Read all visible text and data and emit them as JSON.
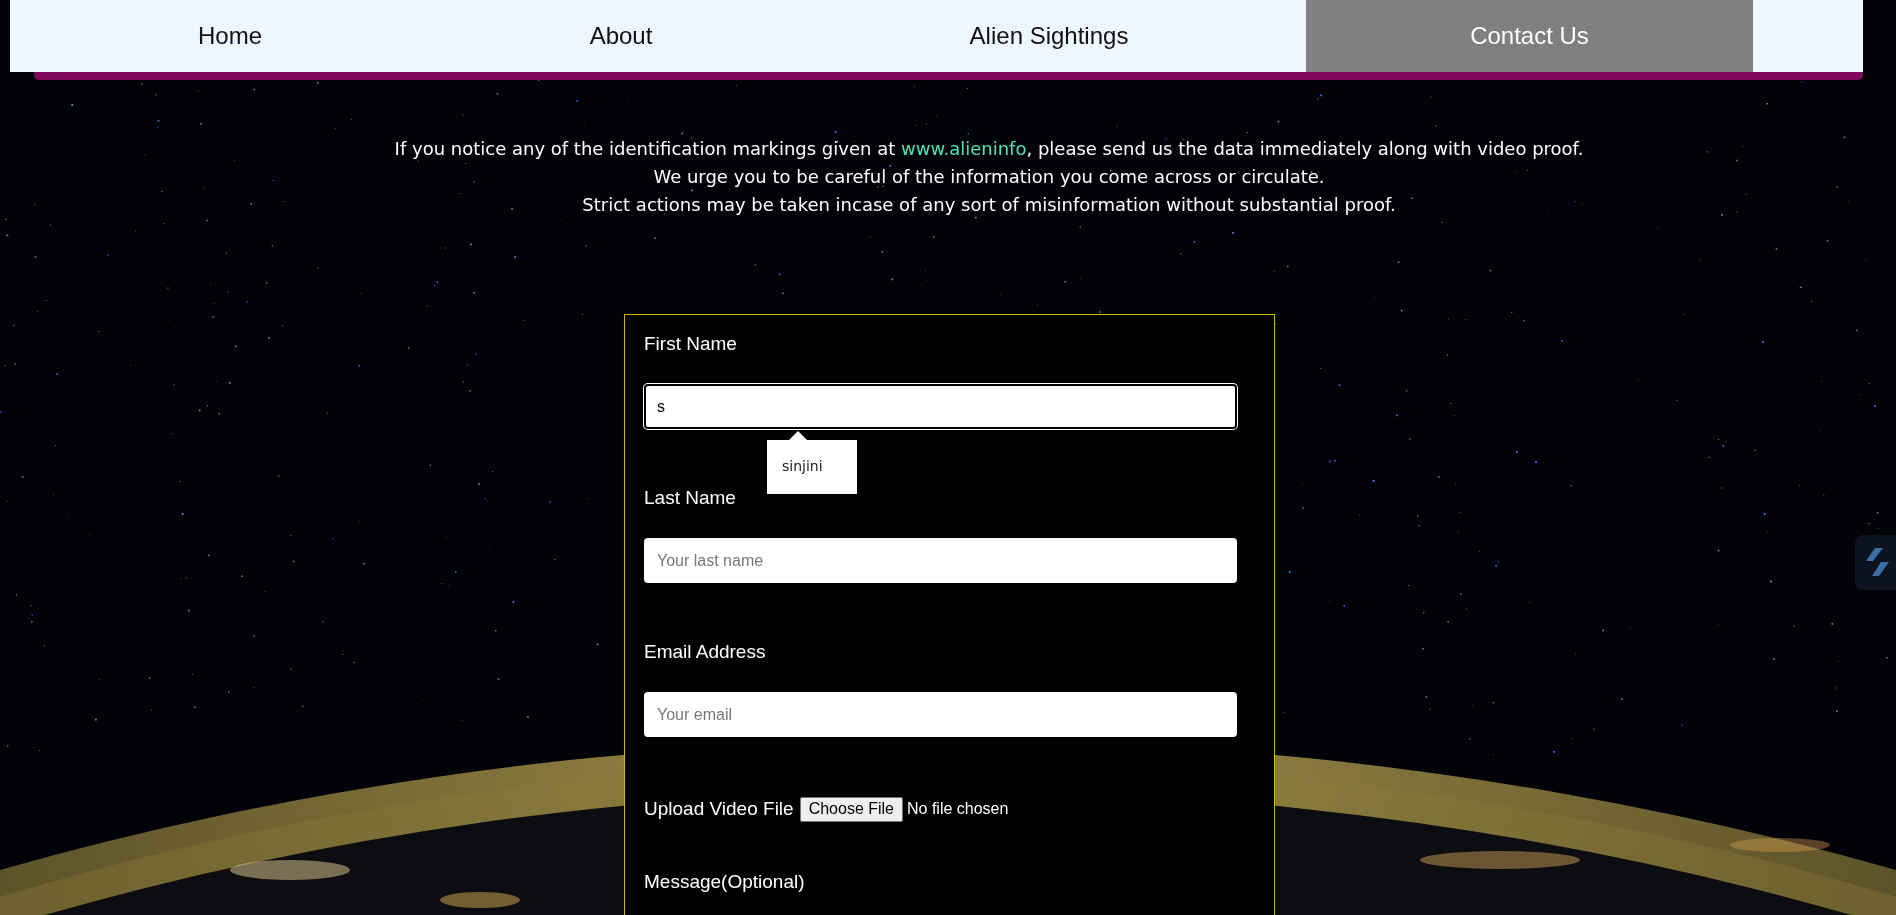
{
  "nav": {
    "tabs": [
      {
        "label": "Home",
        "selected": false
      },
      {
        "label": "About",
        "selected": false
      },
      {
        "label": "Alien Sightings",
        "selected": false
      },
      {
        "label": "Contact Us",
        "selected": true
      }
    ]
  },
  "notice": {
    "lines": [
      {
        "parts": [
          {
            "kind": "text",
            "text": "If you notice any of the identification markings given at "
          },
          {
            "kind": "link",
            "text": "www.alieninfo"
          },
          {
            "kind": "text",
            "text": ", please send us the data immediately along with video proof."
          }
        ]
      },
      {
        "parts": [
          {
            "kind": "text",
            "text": "We urge you to be careful of the information you come across or circulate."
          }
        ]
      },
      {
        "parts": [
          {
            "kind": "text",
            "text": "Strict actions may be taken incase of any sort of misinformation without substantial proof."
          }
        ]
      }
    ]
  },
  "form": {
    "fields": [
      {
        "kind": "text",
        "label": "First Name",
        "value": "s",
        "focused": true,
        "autocomplete": {
          "suggestion": "sinjini"
        }
      },
      {
        "kind": "text",
        "label": "Last Name",
        "placeholder": "Your last name",
        "focused": false
      },
      {
        "kind": "text",
        "label": "Email Address",
        "placeholder": "Your email",
        "focused": false
      },
      {
        "kind": "file",
        "label": "Upload Video File",
        "button": "Choose File",
        "status": "No file chosen"
      },
      {
        "kind": "textarea",
        "label": "Message(Optional)"
      }
    ]
  }
}
